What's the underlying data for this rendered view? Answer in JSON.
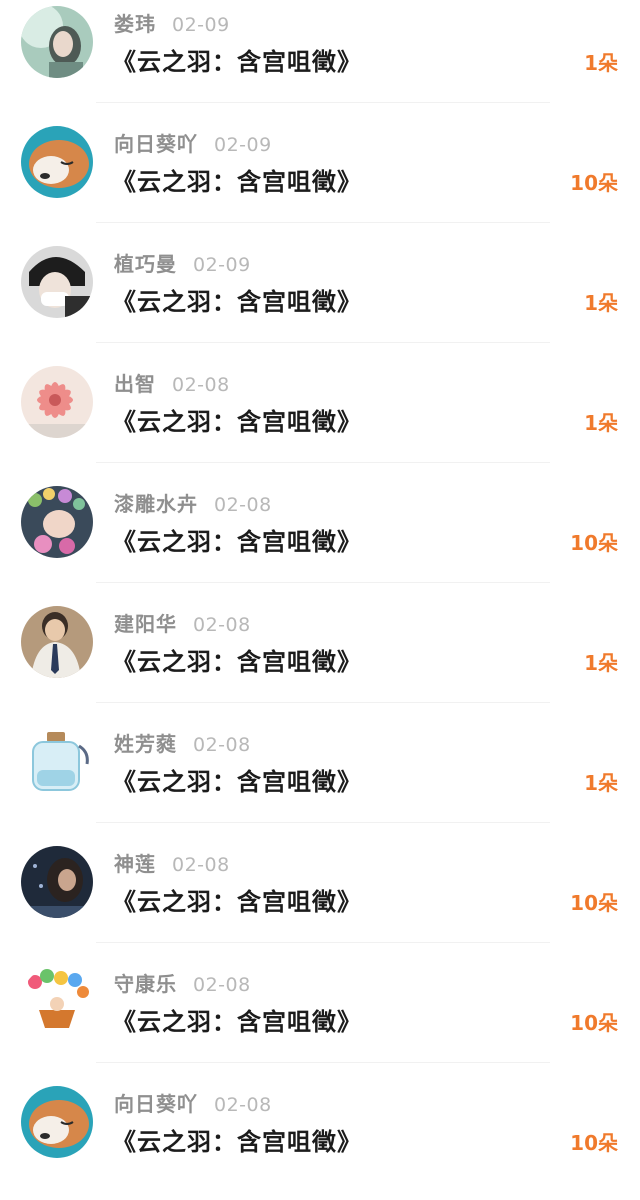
{
  "items": [
    {
      "name": "娄玮",
      "date": "02-09",
      "title": "《云之羽：含宫咀徵》",
      "gift": "1朵",
      "avatar": "woman-portrait-avatar"
    },
    {
      "name": "向日葵吖",
      "date": "02-09",
      "title": "《云之羽：含宫咀徵》",
      "gift": "10朵",
      "avatar": "sleeping-dog-avatar"
    },
    {
      "name": "植巧曼",
      "date": "02-09",
      "title": "《云之羽：含宫咀徵》",
      "gift": "1朵",
      "avatar": "masked-person-avatar"
    },
    {
      "name": "出智",
      "date": "02-08",
      "title": "《云之羽：含宫咀徵》",
      "gift": "1朵",
      "avatar": "pink-flower-avatar"
    },
    {
      "name": "漆雕水卉",
      "date": "02-08",
      "title": "《云之羽：含宫咀徵》",
      "gift": "10朵",
      "avatar": "flower-crown-avatar"
    },
    {
      "name": "建阳华",
      "date": "02-08",
      "title": "《云之羽：含宫咀徵》",
      "gift": "1朵",
      "avatar": "student-avatar"
    },
    {
      "name": "姓芳蕤",
      "date": "02-08",
      "title": "《云之羽：含宫咀徵》",
      "gift": "1朵",
      "avatar": "glass-bottle-avatar"
    },
    {
      "name": "神莲",
      "date": "02-08",
      "title": "《云之羽：含宫咀徵》",
      "gift": "10朵",
      "avatar": "night-person-avatar"
    },
    {
      "name": "守康乐",
      "date": "02-08",
      "title": "《云之羽：含宫咀徵》",
      "gift": "10朵",
      "avatar": "balloon-basket-avatar"
    },
    {
      "name": "向日葵吖",
      "date": "02-08",
      "title": "《云之羽：含宫咀徵》",
      "gift": "10朵",
      "avatar": "sleeping-dog-avatar"
    }
  ],
  "colors": {
    "gift": "#f07a2c",
    "name": "#8f8f8f",
    "date": "#b8b8b8",
    "title": "#1c1c1c"
  }
}
